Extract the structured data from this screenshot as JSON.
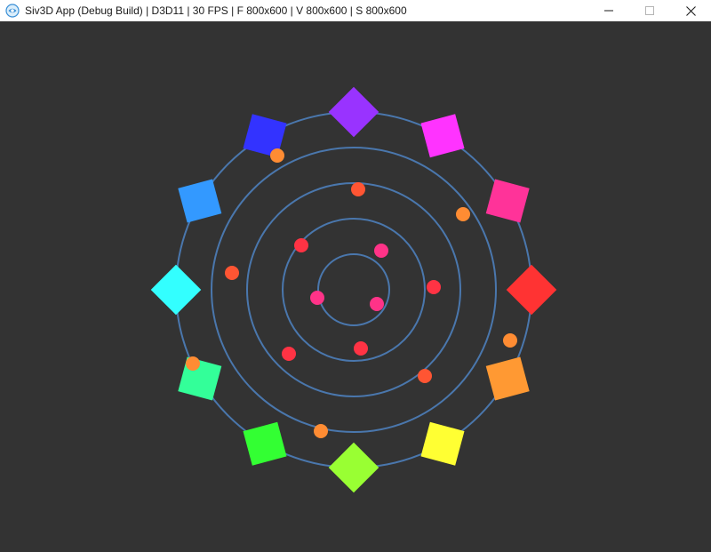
{
  "window": {
    "title": "Siv3D App (Debug Build) | D3D11 | 30 FPS | F 800x600 | V 800x600 | S 800x600",
    "app_icon": "siv3d-logo-icon",
    "controls": {
      "minimize_icon": "minimize-icon",
      "maximize_icon": "maximize-icon",
      "close_icon": "close-icon"
    }
  },
  "scene": {
    "background_color": "#333333",
    "ring_color": "#4a77ad",
    "ring_count": 5,
    "outer_squares": [
      {
        "color": "#9933ff",
        "shape": "diamond"
      },
      {
        "color": "#ff33ff",
        "shape": "square"
      },
      {
        "color": "#ff3399",
        "shape": "square"
      },
      {
        "color": "#ff3333",
        "shape": "diamond"
      },
      {
        "color": "#ff9933",
        "shape": "square"
      },
      {
        "color": "#ffff33",
        "shape": "square"
      },
      {
        "color": "#99ff33",
        "shape": "diamond"
      },
      {
        "color": "#33ff33",
        "shape": "square"
      },
      {
        "color": "#33ff99",
        "shape": "square"
      },
      {
        "color": "#33ffff",
        "shape": "diamond"
      },
      {
        "color": "#3399ff",
        "shape": "square"
      },
      {
        "color": "#3333ff",
        "shape": "square"
      }
    ],
    "dot_colors": {
      "orange": "#ff8c33",
      "red_orange": "#ff5533",
      "red": "#ff3344",
      "pink": "#ff3388"
    }
  }
}
